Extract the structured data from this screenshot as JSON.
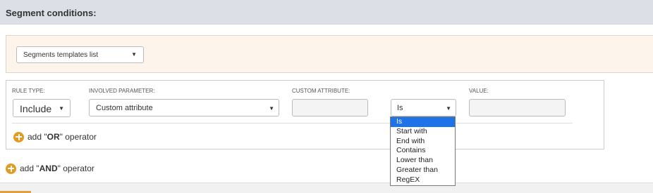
{
  "header": {
    "title": "Segment conditions:"
  },
  "templates": {
    "select_label": "Segments templates list",
    "caret": "▼"
  },
  "rule": {
    "columns": {
      "rule_type": "RULE TYPE:",
      "involved_parameter": "INVOLVED PARAMETER:",
      "custom_attribute": "CUSTOM ATTRIBUTE:",
      "value": "VALUE:"
    },
    "rule_type_value": "Include",
    "parameter_value": "Custom attribute",
    "operator_value": "Is",
    "custom_attribute_value": "",
    "value_value": "",
    "caret": "▼"
  },
  "add_or": {
    "prefix": "add \"",
    "keyword": "OR",
    "suffix": "\" operator"
  },
  "add_and": {
    "prefix": "add \"",
    "keyword": "AND",
    "suffix": "\" operator"
  },
  "operator_dropdown": {
    "options": [
      "Is",
      "Start with",
      "End with",
      "Contains",
      "Lower than",
      "Greater than",
      "RegEX"
    ],
    "selected": "Is"
  },
  "colors": {
    "accent_orange": "#e39a1f",
    "selected_blue": "#1e73e8",
    "header_gray": "#dcdfe6",
    "templates_panel_bg": "#fdf5ec"
  }
}
